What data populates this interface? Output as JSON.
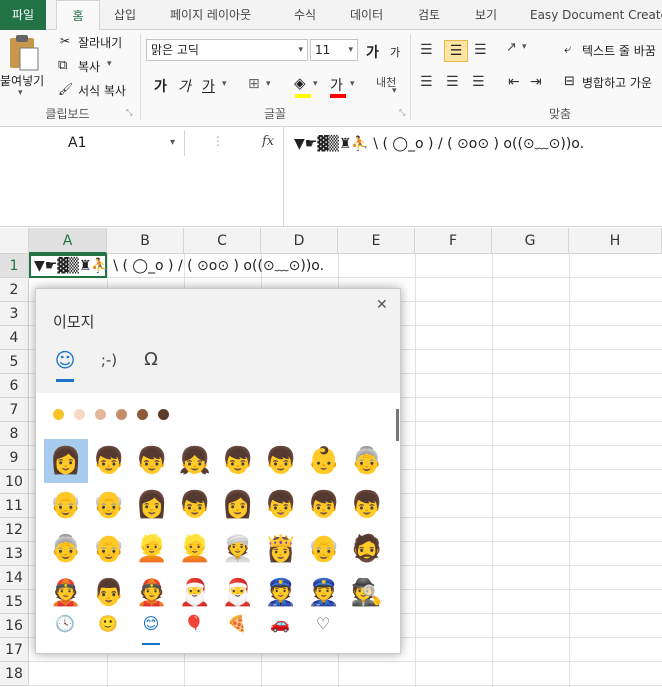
{
  "tabs": [
    "파일",
    "홈",
    "삽입",
    "페이지 레이아웃",
    "수식",
    "데이터",
    "검토",
    "보기",
    "Easy Document Creator"
  ],
  "ribbon": {
    "clipboard": {
      "paste": "붙여넣기",
      "cut": "잘라내기",
      "copy": "복사",
      "format_painter": "서식 복사",
      "label": "클립보드"
    },
    "font": {
      "family": "맑은 고딕",
      "size": "11",
      "grow": "가",
      "shrink": "가",
      "bold": "가",
      "italic": "가",
      "underline": "가",
      "label": "글꼴"
    },
    "align": {
      "wrap": "텍스트 줄 바꿈",
      "merge": "병합하고 가운",
      "label": "맞춤"
    }
  },
  "namebox": "A1",
  "fx": "fx",
  "formula": "▼☛▓▒♜⛹ \\ ( ◯_o ) / ( ⊙o⊙ ) o((⊙﹏⊙))o.",
  "columns": [
    "A",
    "B",
    "C",
    "D",
    "E",
    "F",
    "G",
    "H"
  ],
  "rows": [
    "1",
    "2",
    "3",
    "4",
    "5",
    "6",
    "7",
    "8",
    "9",
    "10",
    "11",
    "12",
    "13",
    "14",
    "15",
    "16",
    "17",
    "18"
  ],
  "cell_a1": "▼☛▓▒♜⛹ \\ ( ◯_o ) / ( ⊙o⊙ ) o((⊙﹏⊙))o.",
  "emoji_panel": {
    "title": "이모지",
    "close": "✕",
    "tabs": [
      "☺",
      ";-)",
      "Ω"
    ],
    "tones": [
      "#f7c325",
      "#fad9c4",
      "#e3b79b",
      "#c68e6a",
      "#8d5a3c",
      "#5b3a29"
    ],
    "emojis": [
      [
        "👩",
        "👦",
        "👦",
        "👧",
        "👦",
        "👦",
        "👶",
        "👵"
      ],
      [
        "👴",
        "👴",
        "👩",
        "👦",
        "👩",
        "👦",
        "👦",
        "👦"
      ],
      [
        "👵",
        "👴",
        "👱",
        "👱",
        "👳",
        "👸",
        "👴",
        "🧔"
      ],
      [
        "👲",
        "👨",
        "👲",
        "🎅",
        "🎅",
        "👮",
        "👮",
        "🕵"
      ]
    ],
    "categories": [
      "🕓",
      "🙂",
      "😊",
      "🎈",
      "🍕",
      "🚗",
      "♡"
    ]
  }
}
